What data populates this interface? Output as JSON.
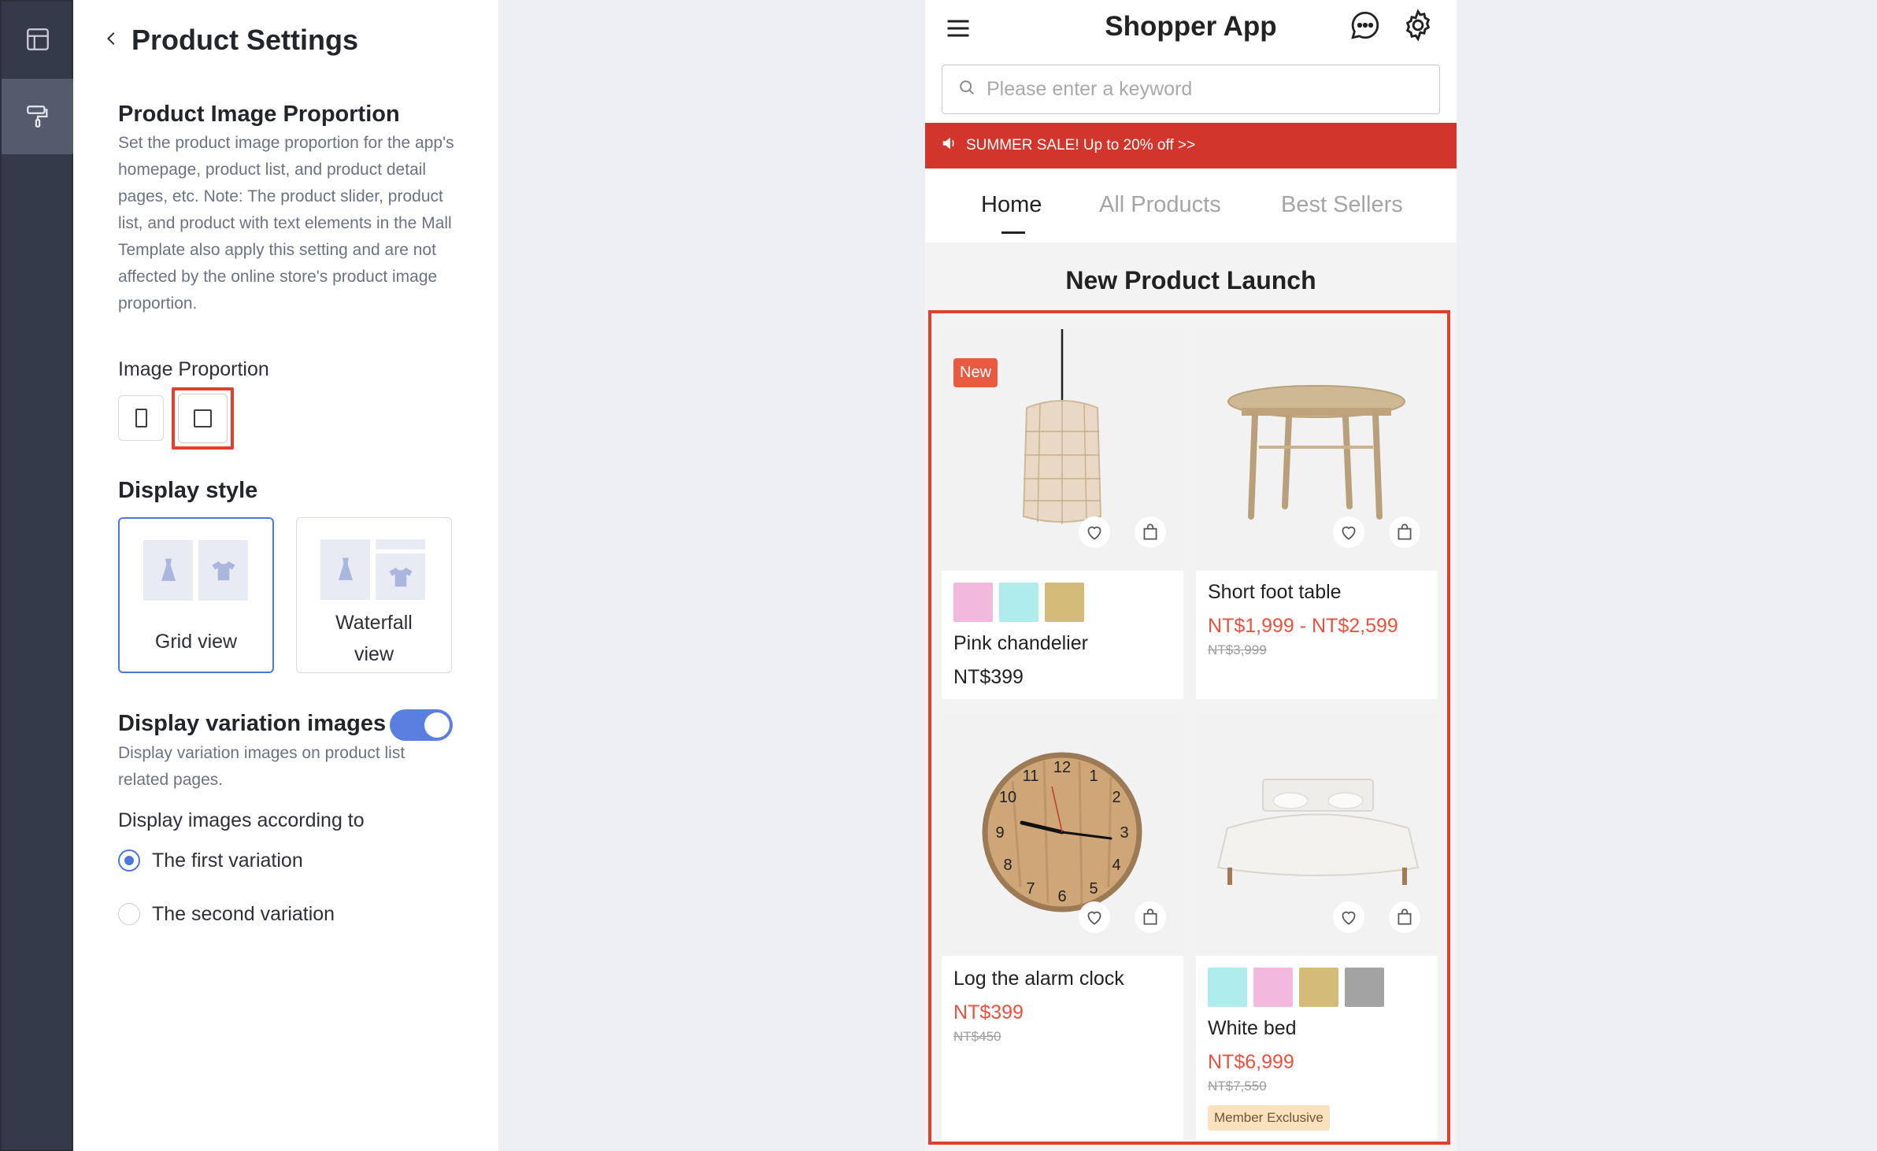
{
  "sidebar": {
    "items": [
      {
        "icon": "layout-icon"
      },
      {
        "icon": "paint-roller-icon",
        "active": true
      }
    ]
  },
  "settings": {
    "title": "Product Settings",
    "image_proportion": {
      "title": "Product Image Proportion",
      "description": "Set the product image proportion for the app's homepage, product list, and product detail pages, etc. Note: The product slider, product list, and product with text elements in the Mall Template also apply this setting and are not affected by the online store's product image proportion.",
      "label": "Image Proportion",
      "options": [
        "portrait",
        "square"
      ],
      "selected": "square"
    },
    "display_style": {
      "title": "Display style",
      "options": [
        {
          "label": "Grid view",
          "selected": true
        },
        {
          "label": "Waterfall view",
          "selected": false
        }
      ]
    },
    "variation_images": {
      "title": "Display variation images",
      "enabled": true,
      "description": "Display variation images on product list related pages.",
      "according_label": "Display images according to",
      "options": [
        {
          "label": "The first variation",
          "checked": true
        },
        {
          "label": "The second variation",
          "checked": false
        }
      ]
    }
  },
  "preview": {
    "app_title": "Shopper App",
    "search_placeholder": "Please enter a keyword",
    "promo": "SUMMER SALE! Up to 20% off >>",
    "tabs": [
      "Home",
      "All Products",
      "Best Sellers"
    ],
    "active_tab": "Home",
    "section_title": "New Product Launch",
    "products": [
      {
        "name": "Pink chandelier",
        "price": "NT$399",
        "badge": "New",
        "swatches": [
          "#f2b8de",
          "#aeecee",
          "#d4bc78"
        ]
      },
      {
        "name": "Short foot table",
        "price": "NT$1,999 - NT$2,599",
        "old_price": "NT$3,999"
      },
      {
        "name": "Log the alarm clock",
        "price": "NT$399",
        "old_price": "NT$450"
      },
      {
        "name": "White bed",
        "price": "NT$6,999",
        "old_price": "NT$7,550",
        "tag": "Member Exclusive",
        "swatches": [
          "#aeecee",
          "#f2b8de",
          "#d4bc78",
          "#a3a3a3"
        ]
      }
    ]
  },
  "colors": {
    "accent_blue": "#4c78db",
    "highlight_red": "#e2402f",
    "promo_red": "#d2352b",
    "sale_red": "#e8523e"
  }
}
